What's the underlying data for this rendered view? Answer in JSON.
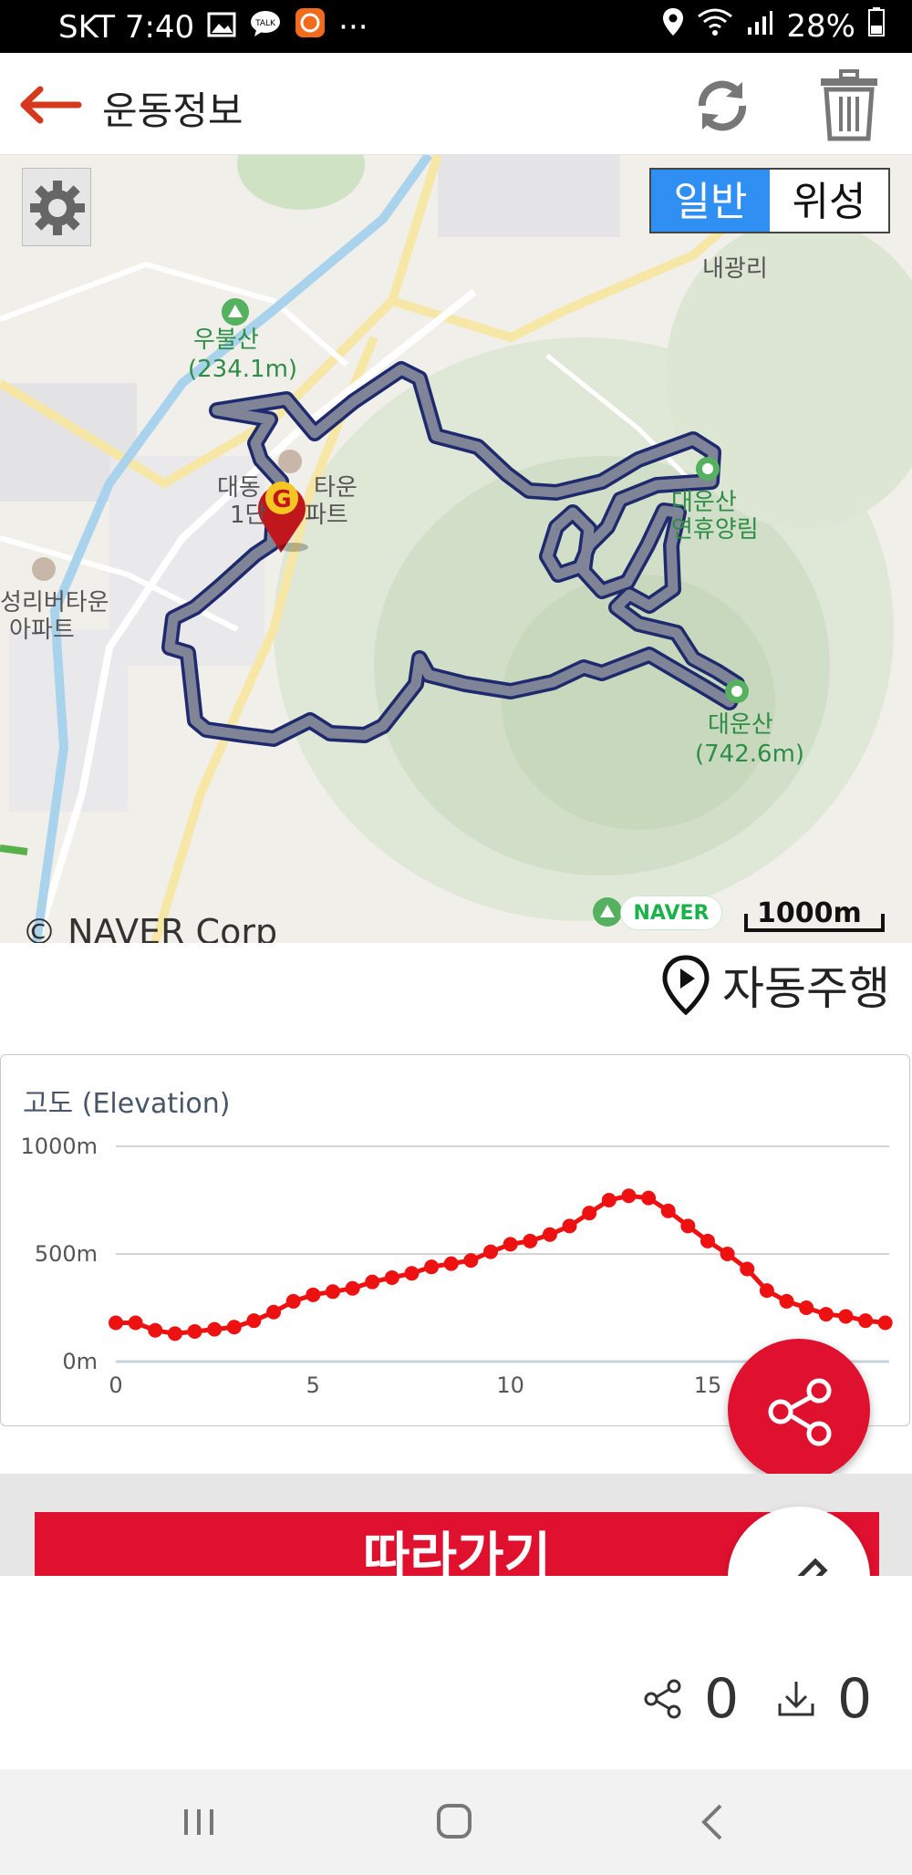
{
  "status_bar": {
    "carrier_time": "SKT 7:40",
    "more": "···",
    "battery": "28%"
  },
  "app_bar": {
    "title": "운동정보",
    "icons": [
      "back-arrow-icon",
      "refresh-icon",
      "trash-icon"
    ]
  },
  "map": {
    "settings_icon": "gear-icon",
    "map_type": {
      "normal": "일반",
      "satellite": "위성"
    },
    "labels": {
      "naegwang": "내광리",
      "ubulsan": "우불산",
      "ubulsan_height": "(234.1m)",
      "apartment1_line1": "대동",
      "apartment1_suffix": "타운",
      "apartment1_line2": "1단",
      "apartment1_line2b": "파트",
      "daeunsan_forest_line1": "대운산",
      "daeunsan_forest_line2": "연휴양림",
      "apartment2_line1": "성리버타운",
      "apartment2_line2": "아파트",
      "daeunsan": "대운산",
      "daeunsan_height": "(742.6m)"
    },
    "marker_letter": "G",
    "naver_logo": "NAVER",
    "scale": "1000m",
    "copyright": "© NAVER Corp"
  },
  "auto_play": {
    "label": "자동주행"
  },
  "elevation_chart": {
    "title": "고도 (Elevation)",
    "y_ticks": [
      "1000m",
      "500m",
      "0m"
    ],
    "x_ticks": [
      "0",
      "5",
      "10",
      "15"
    ]
  },
  "chart_data": {
    "type": "line",
    "title": "고도 (Elevation)",
    "xlabel": "",
    "ylabel": "",
    "ylim": [
      0,
      1000
    ],
    "xlim": [
      0,
      19.6
    ],
    "grid": true,
    "color": "#ee1111",
    "x": [
      0,
      0.5,
      1,
      1.5,
      2,
      2.5,
      3,
      3.5,
      4,
      4.5,
      5,
      5.5,
      6,
      6.5,
      7,
      7.5,
      8,
      8.5,
      9,
      9.5,
      10,
      10.5,
      11,
      11.5,
      12,
      12.5,
      13,
      13.5,
      14,
      14.5,
      15,
      15.5,
      16,
      16.5,
      17,
      17.5,
      18,
      18.5,
      19,
      19.5
    ],
    "values": [
      180,
      180,
      145,
      130,
      140,
      150,
      160,
      190,
      230,
      280,
      310,
      325,
      340,
      370,
      390,
      410,
      440,
      455,
      470,
      510,
      545,
      560,
      590,
      630,
      690,
      750,
      770,
      760,
      700,
      630,
      560,
      500,
      430,
      330,
      280,
      250,
      220,
      210,
      190,
      180
    ]
  },
  "follow_button": {
    "label": "따라가기"
  },
  "stats": {
    "shares": "0",
    "downloads": "0"
  },
  "colors": {
    "accent": "#e0102f",
    "route": "#7f8597",
    "route_outline": "#1f2a6e",
    "map_type_active": "#2f8ff2"
  }
}
